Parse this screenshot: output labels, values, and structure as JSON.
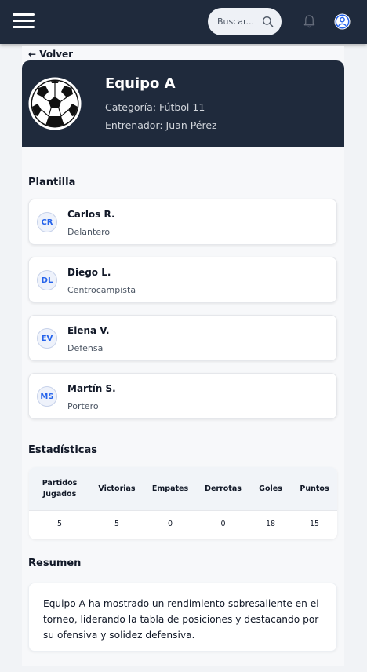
{
  "header": {
    "search_placeholder": "Buscar...",
    "menu_icon": "hamburger-icon",
    "notifications_icon": "bell-icon",
    "profile_icon": "user-circle-icon"
  },
  "back_label": "← Volver",
  "team": {
    "name": "Equipo A",
    "category": "Categoría: Fútbol 11",
    "coach": "Entrenador: Juan Pérez",
    "logo": "soccer-ball-icon"
  },
  "squad": {
    "title": "Plantilla",
    "players": [
      {
        "initials": "CR",
        "name": "Carlos R.",
        "position": "Delantero"
      },
      {
        "initials": "DL",
        "name": "Diego L.",
        "position": "Centrocampista"
      },
      {
        "initials": "EV",
        "name": "Elena V.",
        "position": "Defensa"
      },
      {
        "initials": "MS",
        "name": "Martín S.",
        "position": "Portero"
      }
    ]
  },
  "stats": {
    "title": "Estadísticas",
    "headers": [
      "Partidos Jugados",
      "Victorias",
      "Empates",
      "Derrotas",
      "Goles",
      "Puntos"
    ],
    "values": [
      "5",
      "5",
      "0",
      "0",
      "18",
      "15"
    ]
  },
  "summary": {
    "title": "Resumen",
    "text": "Equipo A ha mostrado un rendimiento sobresaliente en el torneo, liderando la tabla de posiciones y destacando por su ofensiva y solidez defensiva."
  },
  "colors": {
    "navbar": "#1f2a3c",
    "accent": "#2563eb",
    "background": "#f1f3f6"
  }
}
